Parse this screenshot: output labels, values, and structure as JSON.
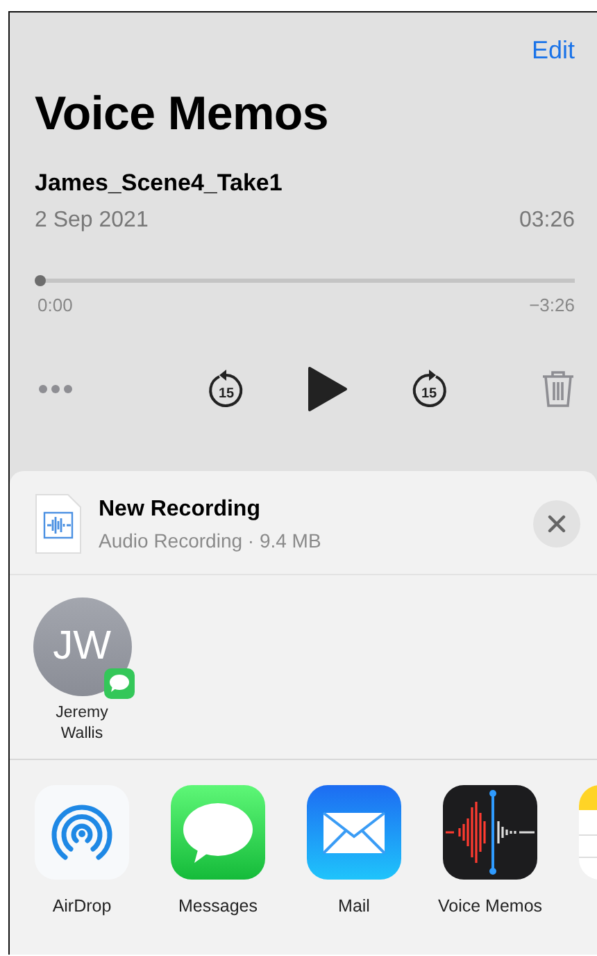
{
  "nav": {
    "action": "Edit"
  },
  "title": "Voice Memos",
  "recording": {
    "name": "James_Scene4_Take1",
    "date": "2 Sep 2021",
    "duration": "03:26"
  },
  "playback": {
    "level": 0,
    "elapsed": "0:00",
    "remaining": "−3:26",
    "skip_back": "15",
    "skip_forward": "15"
  },
  "share_sheet": {
    "file": {
      "name": "New Recording",
      "details": "Audio Recording · 9.4 MB"
    },
    "contacts": [
      {
        "initials": "JW",
        "name": "Jeremy Wallis",
        "messages_badge": true
      }
    ],
    "apps": [
      {
        "kind": "airdrop",
        "label": "AirDrop"
      },
      {
        "kind": "messages",
        "label": "Messages"
      },
      {
        "kind": "mail",
        "label": "Mail"
      },
      {
        "kind": "voice-memos",
        "label": "Voice Memos"
      },
      {
        "kind": "notes"
      }
    ]
  }
}
